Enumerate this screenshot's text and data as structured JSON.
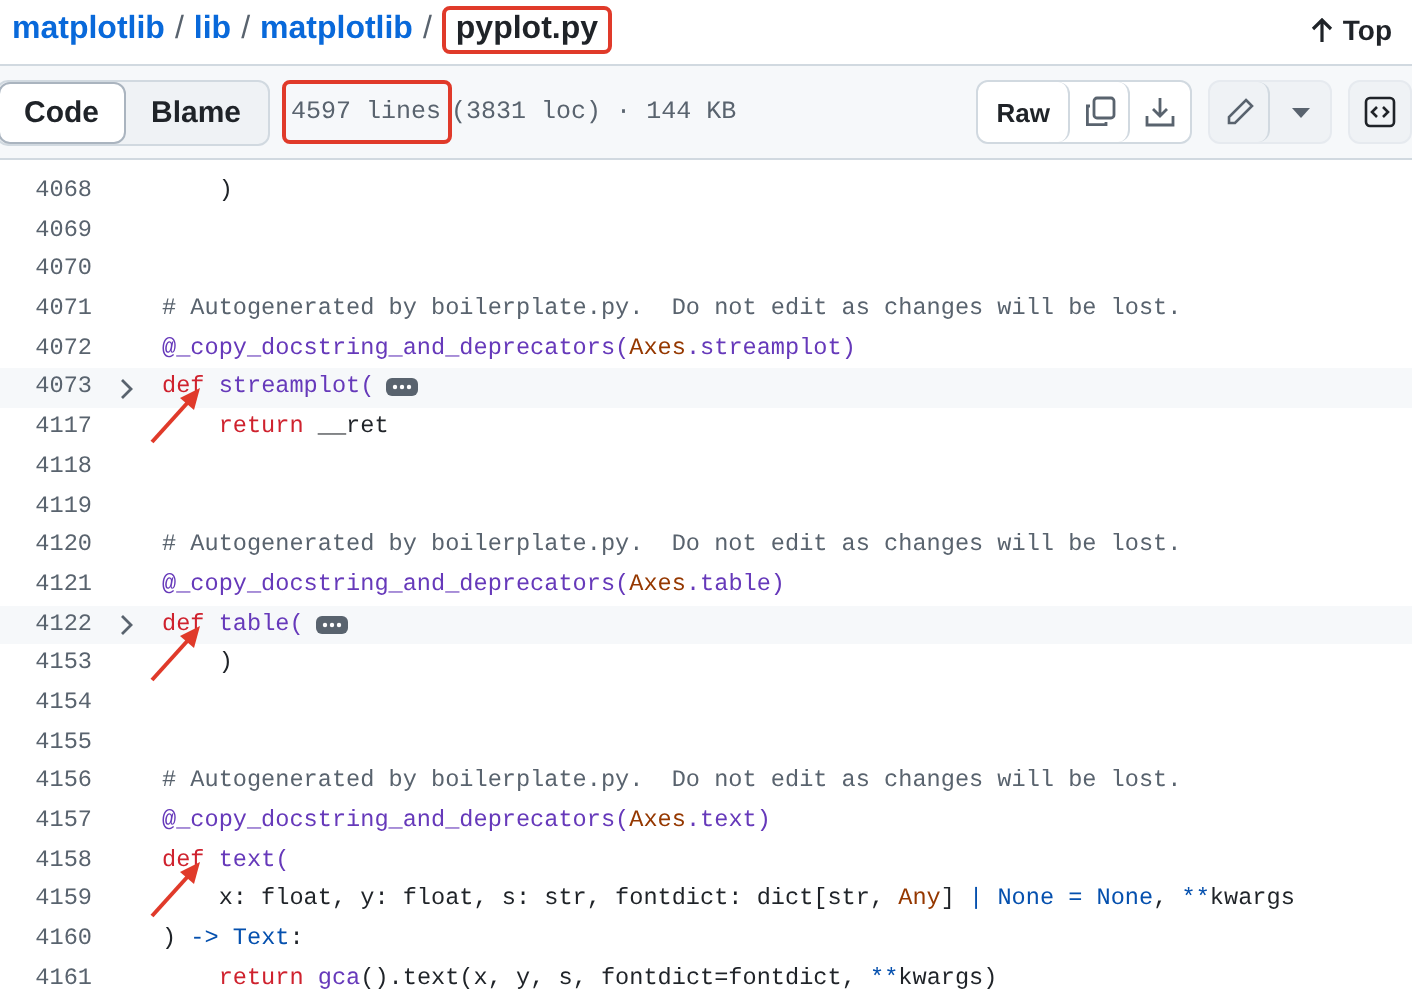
{
  "breadcrumb": [
    {
      "label": "matplotlib",
      "current": false,
      "boxed": false
    },
    {
      "label": "lib",
      "current": false,
      "boxed": false
    },
    {
      "label": "matplotlib",
      "current": false,
      "boxed": false
    },
    {
      "label": "pyplot.py",
      "current": true,
      "boxed": true
    }
  ],
  "breadcrumb_separator": "/",
  "top_link": "Top",
  "tabs": [
    {
      "label": "Code",
      "selected": true
    },
    {
      "label": "Blame",
      "selected": false
    }
  ],
  "file_info": {
    "lines": "4597 lines",
    "lines_boxed": true,
    "details": "(3831 loc) · 144 KB"
  },
  "raw_button": "Raw",
  "code_lines": [
    {
      "number": "4068",
      "folded": false,
      "annotated": false,
      "tokens": [
        {
          "kind": "plain",
          "text": "    )"
        }
      ]
    },
    {
      "number": "4069",
      "folded": false,
      "annotated": false
    },
    {
      "number": "4070",
      "folded": false,
      "annotated": false
    },
    {
      "number": "4071",
      "folded": false,
      "annotated": false,
      "tokens": [
        {
          "kind": "comment",
          "text": "# Autogenerated by boilerplate.py.  Do not edit as changes will be lost."
        }
      ]
    },
    {
      "number": "4072",
      "folded": false,
      "annotated": false,
      "tokens": [
        {
          "kind": "decorator",
          "text": "@_copy_docstring_and_deprecators("
        },
        {
          "kind": "type",
          "text": "Axes"
        },
        {
          "kind": "decorator",
          "text": ".streamplot)"
        }
      ]
    },
    {
      "number": "4073",
      "folded": true,
      "annotated": true,
      "tokens": [
        {
          "kind": "keyword",
          "text": "def"
        },
        {
          "kind": "function",
          "text": " streamplot("
        }
      ]
    },
    {
      "number": "4117",
      "folded": false,
      "annotated": false,
      "tokens": [
        {
          "kind": "keyword",
          "text": "    return"
        },
        {
          "kind": "plain",
          "text": " __ret"
        }
      ]
    },
    {
      "number": "4118",
      "folded": false,
      "annotated": false
    },
    {
      "number": "4119",
      "folded": false,
      "annotated": false
    },
    {
      "number": "4120",
      "folded": false,
      "annotated": false,
      "tokens": [
        {
          "kind": "comment",
          "text": "# Autogenerated by boilerplate.py.  Do not edit as changes will be lost."
        }
      ]
    },
    {
      "number": "4121",
      "folded": false,
      "annotated": false,
      "tokens": [
        {
          "kind": "decorator",
          "text": "@_copy_docstring_and_deprecators("
        },
        {
          "kind": "type",
          "text": "Axes"
        },
        {
          "kind": "decorator",
          "text": ".table)"
        }
      ]
    },
    {
      "number": "4122",
      "folded": true,
      "annotated": true,
      "tokens": [
        {
          "kind": "keyword",
          "text": "def"
        },
        {
          "kind": "function",
          "text": " table("
        }
      ]
    },
    {
      "number": "4153",
      "folded": false,
      "annotated": false,
      "tokens": [
        {
          "kind": "plain",
          "text": "    )"
        }
      ]
    },
    {
      "number": "4154",
      "folded": false,
      "annotated": false
    },
    {
      "number": "4155",
      "folded": false,
      "annotated": false
    },
    {
      "number": "4156",
      "folded": false,
      "annotated": false,
      "tokens": [
        {
          "kind": "comment",
          "text": "# Autogenerated by boilerplate.py.  Do not edit as changes will be lost."
        }
      ]
    },
    {
      "number": "4157",
      "folded": false,
      "annotated": false,
      "tokens": [
        {
          "kind": "decorator",
          "text": "@_copy_docstring_and_deprecators("
        },
        {
          "kind": "type",
          "text": "Axes"
        },
        {
          "kind": "decorator",
          "text": ".text)"
        }
      ]
    },
    {
      "number": "4158",
      "folded": false,
      "annotated": true,
      "tokens": [
        {
          "kind": "keyword",
          "text": "def"
        },
        {
          "kind": "function",
          "text": " text("
        }
      ]
    },
    {
      "number": "4159",
      "folded": false,
      "annotated": false,
      "tokens": [
        {
          "kind": "plain",
          "text": "    x: float, y: float, s: str, fontdict: dict[str, "
        },
        {
          "kind": "type",
          "text": "Any"
        },
        {
          "kind": "plain",
          "text": "] "
        },
        {
          "kind": "constant",
          "text": "| None = None"
        },
        {
          "kind": "plain",
          "text": ", "
        },
        {
          "kind": "constant",
          "text": "**"
        },
        {
          "kind": "plain",
          "text": "kwargs"
        }
      ]
    },
    {
      "number": "4160",
      "folded": false,
      "annotated": false,
      "tokens": [
        {
          "kind": "plain",
          "text": ") "
        },
        {
          "kind": "constant",
          "text": "-> Text"
        },
        {
          "kind": "plain",
          "text": ":"
        }
      ]
    },
    {
      "number": "4161",
      "folded": false,
      "annotated": false,
      "tokens": [
        {
          "kind": "keyword",
          "text": "    return"
        },
        {
          "kind": "function",
          "text": " gca"
        },
        {
          "kind": "plain",
          "text": "().text(x, y, s, fontdict=fontdict, "
        },
        {
          "kind": "constant",
          "text": "**"
        },
        {
          "kind": "plain",
          "text": "kwargs)"
        }
      ]
    }
  ]
}
